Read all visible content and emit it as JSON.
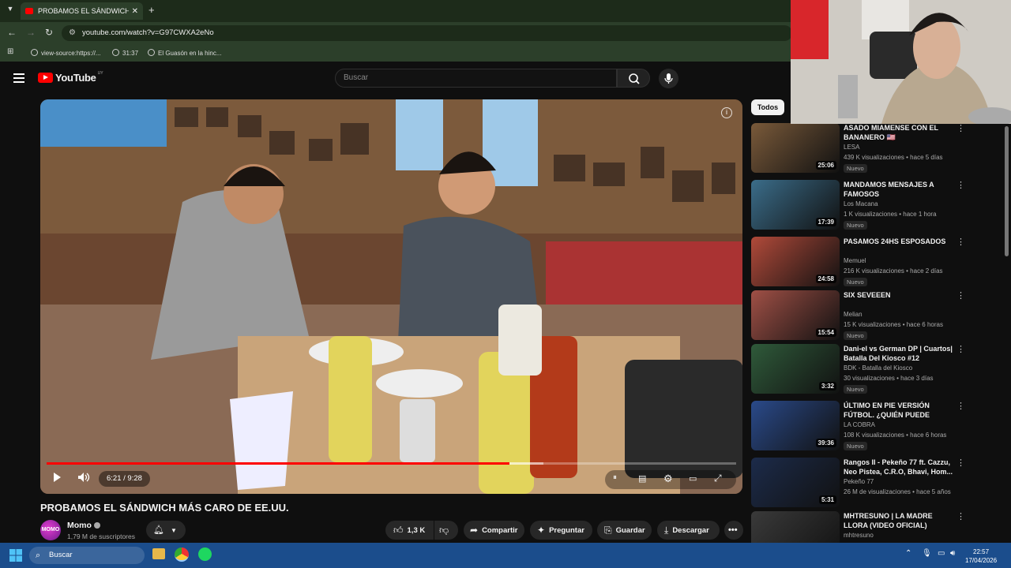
{
  "browser": {
    "tab_title": "PROBAMOS EL SÁNDWICH MÁS CARO DE EE.UU.",
    "url": "youtube.com/watch?v=G97CWXA2eNo",
    "bookmarks": [
      "view-source:https://...",
      "31:37",
      "El Guasón en la hinc..."
    ]
  },
  "masthead": {
    "logo": "YouTube",
    "country": "UY",
    "search_placeholder": "Buscar"
  },
  "player": {
    "time": "6:21 / 9:28",
    "progress": 0.6708,
    "buffered": 0.72
  },
  "video": {
    "title": "PROBAMOS EL SÁNDWICH MÁS CARO DE EE.UU.",
    "channel": "Momo",
    "avatar_text": "MOMO",
    "subscribers": "1,79 M de suscriptores",
    "likes": "1,3 K",
    "share": "Compartir",
    "ask": "Preguntar",
    "save": "Guardar",
    "download": "Descargar"
  },
  "sidebar": {
    "filter": "Todos",
    "items": [
      {
        "title": "ASADO MIAMENSE CON EL BANANERO 🇺🇸",
        "channel": "LESA",
        "meta": "439 K visualizaciones • hace 5 días",
        "badge": "Nuevo",
        "duration": "25:06",
        "color": "#7a5a3a"
      },
      {
        "title": "MANDAMOS MENSAJES A FAMOSOS",
        "channel": "Los Macana",
        "meta": "1 K visualizaciones • hace 1 hora",
        "badge": "Nuevo",
        "duration": "17:39",
        "color": "#3b6d8a"
      },
      {
        "title": "PASAMOS 24HS ESPOSADOS",
        "channel": "Memuel",
        "meta": "216 K visualizaciones • hace 2 días",
        "badge": "Nuevo",
        "duration": "24:58",
        "color": "#b14a3a"
      },
      {
        "title": "SIX SEVEEEN",
        "channel": "Melian",
        "meta": "15 K visualizaciones • hace 6 horas",
        "badge": "Nuevo",
        "duration": "15:54",
        "color": "#a05046"
      },
      {
        "title": "Dani-el vs German DP | Cuartos| Batalla Del Kiosco #12",
        "channel": "BDK - Batalla del Kiosco",
        "meta": "30 visualizaciones • hace 3 días",
        "badge": "Nuevo",
        "duration": "3:32",
        "color": "#2f5a3a"
      },
      {
        "title": "ÚLTIMO EN PIE VERSIÓN FÚTBOL. ¿QUIÉN PUEDE DECI...",
        "channel": "LA COBRA",
        "meta": "108 K visualizaciones • hace 6 horas",
        "badge": "Nuevo",
        "duration": "39:36",
        "color": "#2a4a8a"
      },
      {
        "title": "Rangos II - Pekeño 77 ft. Cazzu, Neo Pistea, C.R.O, Bhavi, Hom...",
        "channel": "Pekeño 77",
        "meta": "26 M de visualizaciones • hace 5 años",
        "badge": "",
        "duration": "5:31",
        "color": "#1c2b4a"
      },
      {
        "title": "MHTRESUNO | LA MADRE LLORA (VIDEO OFICIAL)",
        "channel": "mhtresuno",
        "meta": "",
        "badge": "",
        "duration": "",
        "color": "#3a3a3a"
      }
    ]
  },
  "taskbar": {
    "search": "Buscar",
    "time": "22:57",
    "date": "17/04/2026"
  }
}
